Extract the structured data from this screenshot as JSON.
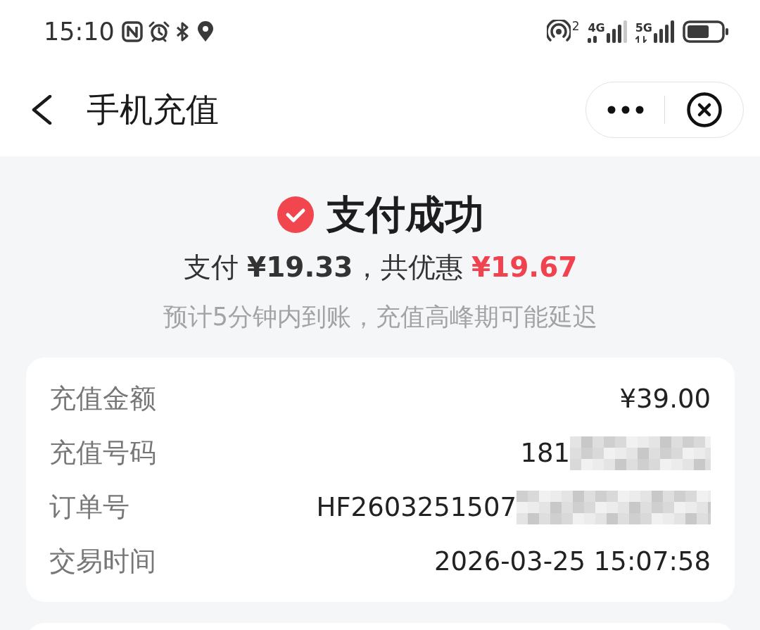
{
  "status_bar": {
    "time": "15:10",
    "hotspot_badge": "2",
    "networks": [
      {
        "label": "4G"
      },
      {
        "label": "5G"
      }
    ]
  },
  "header": {
    "title": "手机充值"
  },
  "result": {
    "title": "支付成功",
    "summary": "支付 **¥19.33**，共优惠 **¥19.67**",
    "note": "预计5分钟内到账，充值高峰期可能延迟"
  },
  "details": {
    "rows": [
      {
        "label": "充值金额",
        "value": "¥39.00",
        "redacted": false
      },
      {
        "label": "充值号码",
        "value": "181",
        "redacted": true
      },
      {
        "label": "订单号",
        "value": "HF2603251507",
        "redacted": true
      },
      {
        "label": "交易时间",
        "value": "2026-03-25 15:07:58",
        "redacted": false
      }
    ]
  }
}
